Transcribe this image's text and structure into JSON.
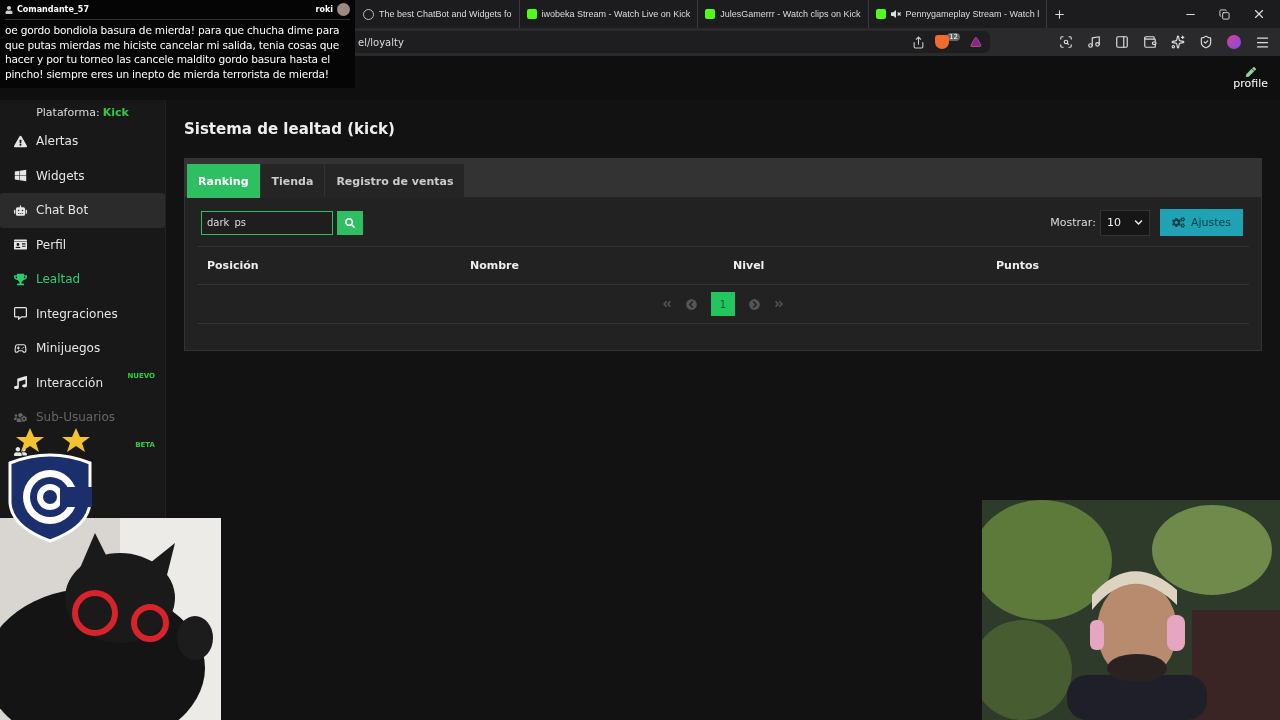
{
  "browser": {
    "tabs": [
      {
        "title": "The best ChatBot and Widgets fo",
        "muted": false
      },
      {
        "title": "iwobeka Stream - Watch Live on Kick",
        "muted": false
      },
      {
        "title": "JulesGamerrr - Watch clips on Kick",
        "muted": false
      },
      {
        "title": "Pennygameplay Stream - Watch l",
        "muted": true
      }
    ],
    "address": "el/loyalty",
    "shield_count": "12"
  },
  "header": {
    "profile": "profile"
  },
  "sidebar": {
    "platform_label": "Plataforma:",
    "platform": "Kick",
    "items": [
      {
        "label": "Alertas",
        "active": false,
        "highlighted": false,
        "disabled": false
      },
      {
        "label": "Widgets",
        "active": false,
        "highlighted": false,
        "disabled": false
      },
      {
        "label": "Chat Bot",
        "active": false,
        "highlighted": true,
        "disabled": false
      },
      {
        "label": "Perfil",
        "active": false,
        "highlighted": false,
        "disabled": false
      },
      {
        "label": "Lealtad",
        "active": true,
        "highlighted": false,
        "disabled": false
      },
      {
        "label": "Integraciones",
        "active": false,
        "highlighted": false,
        "disabled": false
      },
      {
        "label": "Minijuegos",
        "active": false,
        "highlighted": false,
        "disabled": false
      },
      {
        "label": "Interacción",
        "active": false,
        "highlighted": false,
        "disabled": false,
        "badge": "NUEVO"
      },
      {
        "label": "Sub-Usuarios",
        "active": false,
        "highlighted": false,
        "disabled": true
      },
      {
        "active": false,
        "highlighted": false,
        "disabled": false,
        "badge": "BETA"
      }
    ]
  },
  "page": {
    "title": "Sistema de lealtad (kick)",
    "tabs": [
      {
        "label": "Ranking",
        "selected": true
      },
      {
        "label": "Tienda",
        "selected": false
      },
      {
        "label": "Registro de ventas",
        "selected": false
      }
    ],
    "search": {
      "value": "dark_ps"
    },
    "show_label": "Mostrar:",
    "show_value": "10",
    "settings_button": "Ajustes",
    "columns": [
      "Posición",
      "Nombre",
      "Nivel",
      "Puntos"
    ],
    "pages": [
      {
        "label": "1",
        "selected": true
      }
    ]
  },
  "chat": {
    "user": "Comandante_57",
    "channel": "roki",
    "message": "oe gordo bondiola basura de mierda! para que chucha dime para que putas mierdas me hiciste cancelar mi salida, tenia cosas que hacer y por tu torneo las cancele maldito gordo basura hasta el pincho! siempre eres un inepto de mierda terrorista de mierda!"
  }
}
